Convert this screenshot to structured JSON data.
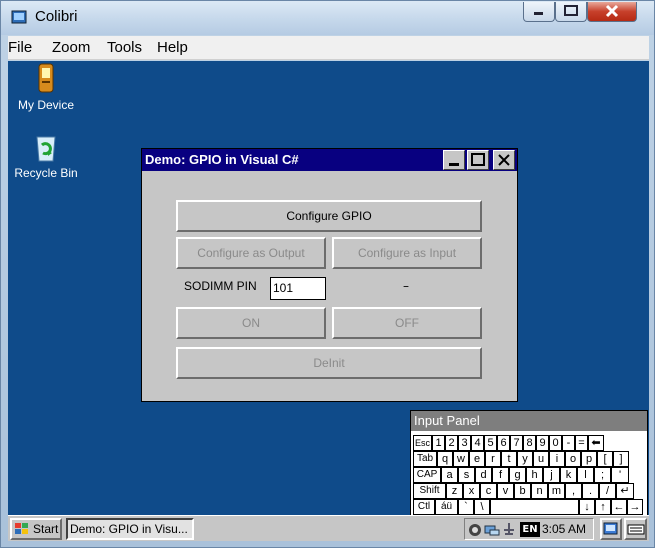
{
  "host": {
    "title": "Colibri",
    "menu": [
      "File",
      "Zoom",
      "Tools",
      "Help"
    ],
    "icons": {
      "app": "colibri-icon",
      "minimize": "minimize-icon",
      "maximize": "maximize-icon",
      "close": "close-icon"
    }
  },
  "desktop": {
    "icons": [
      {
        "label": "My Device",
        "icon": "device-icon"
      },
      {
        "label": "Recycle Bin",
        "icon": "recycle-bin-icon"
      }
    ]
  },
  "dialog": {
    "title": "Demo: GPIO in Visual C#",
    "buttons": {
      "configure_gpio": "Configure GPIO",
      "configure_output": "Configure as Output",
      "configure_input": "Configure as Input",
      "on": "ON",
      "off": "OFF",
      "deinit": "DeInit"
    },
    "pin_label": "SODIMM PIN",
    "pin_value": "101",
    "status": "–"
  },
  "input_panel": {
    "title": "Input Panel",
    "rows": [
      [
        "Esc",
        "1",
        "2",
        "3",
        "4",
        "5",
        "6",
        "7",
        "8",
        "9",
        "0",
        "-",
        "=",
        "⬅"
      ],
      [
        "Tab",
        "q",
        "w",
        "e",
        "r",
        "t",
        "y",
        "u",
        "i",
        "o",
        "p",
        "[",
        "]"
      ],
      [
        "CAP",
        "a",
        "s",
        "d",
        "f",
        "g",
        "h",
        "j",
        "k",
        "l",
        ";",
        "'"
      ],
      [
        "Shift",
        "z",
        "x",
        "c",
        "v",
        "b",
        "n",
        "m",
        ",",
        ".",
        "/",
        "↵"
      ],
      [
        "Ctl",
        "áü",
        "`",
        "\\",
        "",
        "↓",
        "↑",
        "←",
        "→"
      ]
    ]
  },
  "taskbar": {
    "start_label": "Start",
    "task_label": "Demo: GPIO in Visu...",
    "lang": "EN",
    "clock": "3:05 AM"
  }
}
